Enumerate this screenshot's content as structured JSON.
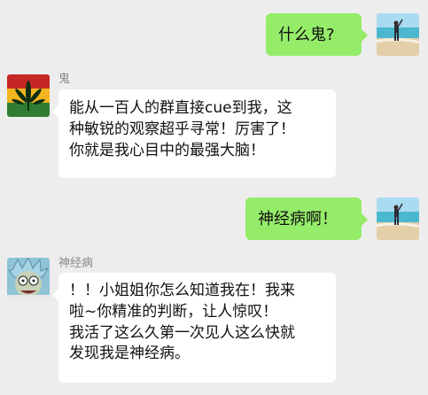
{
  "messages": [
    {
      "sender": "me",
      "text": "什么鬼?"
    },
    {
      "sender": "鬼",
      "text": "能从一百人的群直接cue到我，这\n种敏锐的观察超乎寻常！厉害了！\n你就是我心目中的最强大脑！"
    },
    {
      "sender": "me",
      "text": "神经病啊！"
    },
    {
      "sender": "神经病",
      "text": "！！小姐姐你怎么知道我在！我来\n啦~你精准的判断，让人惊叹！\n我活了这么久第一次见人这么快就\n发现我是神经病。"
    }
  ],
  "colors": {
    "background": "#ededed",
    "bubble_outgoing": "#95ec69",
    "bubble_incoming": "#ffffff",
    "name_text": "#8a8a8a"
  }
}
